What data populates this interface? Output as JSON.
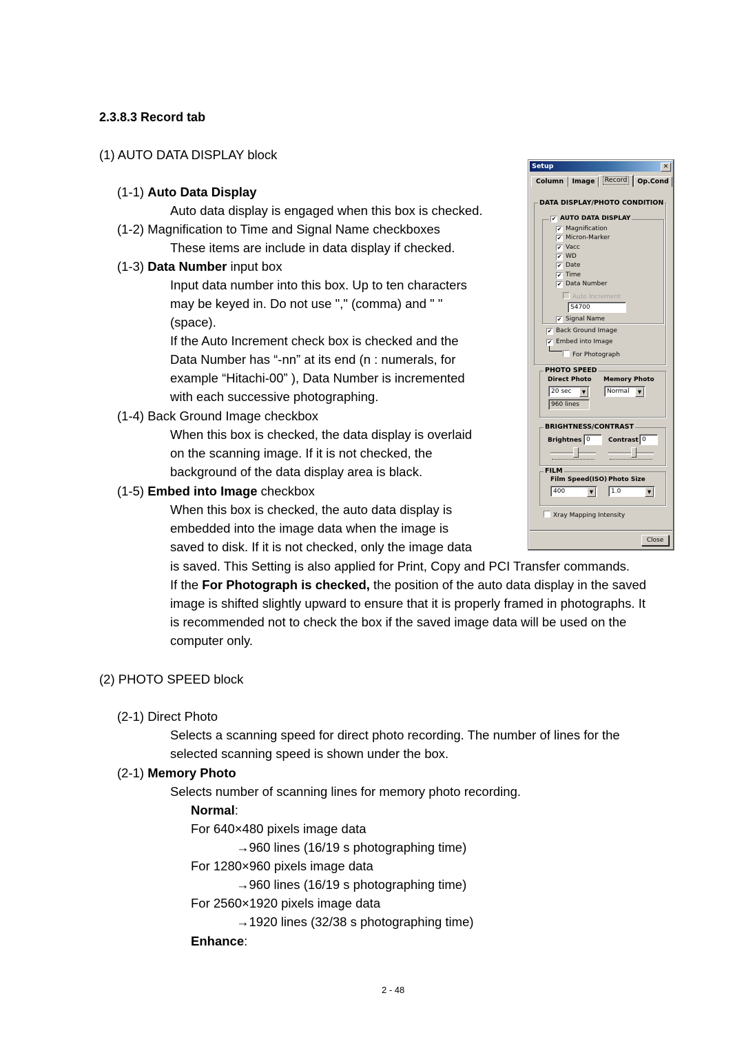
{
  "section_heading": "2.3.8.3 Record tab",
  "block1": {
    "title": "(1) AUTO DATA DISPLAY block",
    "item1_1": {
      "num": "(1-1) ",
      "label": "Auto Data Display",
      "desc": "Auto data display is engaged when this box is checked."
    },
    "item1_2": {
      "text": "(1-2) Magnification to Time and Signal Name checkboxes",
      "desc": "These items are include in data display if checked."
    },
    "item1_3": {
      "num": "(1-3) ",
      "label": "Data Number",
      "suffix": " input box",
      "desc_lines": [
        "Input data number into this box. Up to ten characters",
        "may be keyed in. Do not use \",\" (comma) and \" \"",
        "(space).",
        "If the Auto Increment check box is checked and the",
        "Data Number has “-nn” at its end (n : numerals, for",
        "example “Hitachi-00” ), Data Number is incremented",
        "with each successive photographing."
      ]
    },
    "item1_4": {
      "text": "(1-4) Back Ground Image checkbox",
      "desc_lines": [
        "When this box is checked, the data display is overlaid",
        "on the scanning image. If it is not checked, the",
        "background of the data display area is black."
      ]
    },
    "item1_5": {
      "num": "(1-5) ",
      "label": "Embed into Image",
      "suffix": " checkbox",
      "desc_lines": [
        "When this box is checked, the auto data display is",
        "embedded into the image data when the image is",
        "saved to disk. If it is not checked, only the image data",
        "is saved. This Setting is also applied for Print, Copy and PCI Transfer commands."
      ],
      "note_prefix": "If the ",
      "note_bold": "For Photograph is checked,",
      "note_rest": " the position of the auto data display in the saved",
      "note_lines": [
        "image is shifted slightly upward to ensure that it is properly framed in photographs. It",
        "is recommended not to check the box if the saved image data will be used on the",
        "computer only."
      ]
    }
  },
  "block2": {
    "title": "(2) PHOTO SPEED block",
    "item2_1a": {
      "text": "(2-1) Direct Photo",
      "desc_lines": [
        "Selects a scanning speed for direct photo recording. The number of lines for the",
        "selected scanning speed is shown under the box."
      ]
    },
    "item2_1b": {
      "num": "(2-1) ",
      "label": "Memory Photo",
      "desc": "Selects number of scanning lines for memory photo recording."
    },
    "normal_label": "Normal",
    "colon": ":",
    "normal_rows": [
      {
        "res": "For 640×480 pixels image data",
        "result": "→960 lines (16/19 s photographing time)"
      },
      {
        "res": "For 1280×960 pixels image data",
        "result": "→960 lines (16/19 s photographing time)"
      },
      {
        "res": "For 2560×1920 pixels image data",
        "result": "→1920 lines (32/38 s photographing time)"
      }
    ],
    "enhance_label": "Enhance"
  },
  "page_number": "2 - 48",
  "dialog": {
    "title": "Setup",
    "close_glyph": "✕",
    "tabs": [
      "Column",
      "Image",
      "Record",
      "Op.Cond"
    ],
    "active_tab": "Record",
    "group_main": "DATA DISPLAY/PHOTO CONDITION",
    "auto_data_display": {
      "label": "AUTO DATA  DISPLAY",
      "checked": true
    },
    "check_items": [
      {
        "label": "Magnification",
        "checked": true
      },
      {
        "label": "Micron-Marker",
        "checked": true
      },
      {
        "label": "Vacc",
        "checked": true
      },
      {
        "label": "WD",
        "checked": true
      },
      {
        "label": "Date",
        "checked": true
      },
      {
        "label": "Time",
        "checked": true
      },
      {
        "label": "Data Number",
        "checked": true
      }
    ],
    "auto_increment": {
      "label": "Auto Increment",
      "checked": false,
      "disabled": true
    },
    "data_number_value": "S4700",
    "signal_name": {
      "label": "Signal Name",
      "checked": true
    },
    "back_ground_image": {
      "label": "Back Ground Image",
      "checked": true
    },
    "embed_into_image": {
      "label": "Embed into Image",
      "checked": true
    },
    "for_photograph": {
      "label": "For Photograph",
      "checked": false
    },
    "photo_speed": {
      "label": "PHOTO SPEED",
      "direct_photo_label": "Direct Photo",
      "direct_photo_value": "20 sec",
      "lines_value": "960 lines",
      "memory_photo_label": "Memory Photo",
      "memory_photo_value": "Normal"
    },
    "brightness_contrast": {
      "label": "BRIGHTNESS/CONTRAST",
      "brightness_label": "Brightnes",
      "brightness_value": "0",
      "contrast_label": "Contrast",
      "contrast_value": "0"
    },
    "film": {
      "label": "FILM",
      "film_speed_label": "Film Speed(ISO)",
      "film_speed_value": "400",
      "photo_size_label": "Photo Size",
      "photo_size_value": "1.0"
    },
    "xray_mapping": {
      "label": "Xray Mapping Intensity",
      "checked": false
    },
    "close_button": "Close",
    "check_glyph": "✔",
    "arrow_glyph": "▼"
  }
}
